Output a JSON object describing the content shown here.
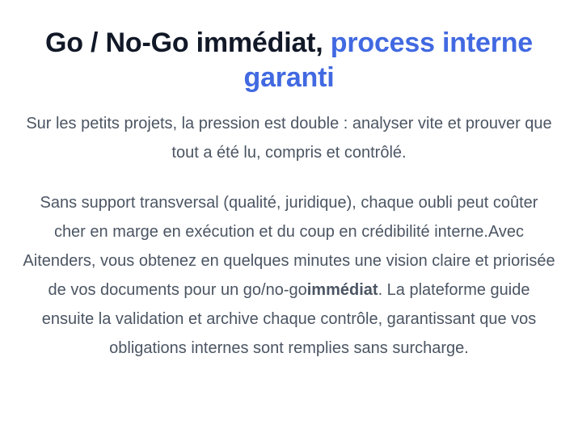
{
  "heading": {
    "part1": "Go / No-Go immédiat,",
    "accent": "process interne garanti"
  },
  "paragraph1": "Sur les petits projets, la pression est double : analyser vite et prouver que tout a été lu, compris et contrôlé.",
  "paragraph2": {
    "text_before": "Sans support transversal (qualité, juridique), chaque oubli peut coûter cher en marge en exécution et du coup en crédibilité interne.Avec Aitenders, vous obtenez en quelques minutes une vision claire et priorisée de vos documents pour un go/no-go",
    "bold": "immédiat",
    "text_after": ". La plateforme guide ensuite la validation et archive chaque contrôle, garantissant que vos obligations internes sont remplies sans surcharge."
  },
  "colors": {
    "heading": "#111827",
    "accent": "#4169e1",
    "body_text": "#4b5563",
    "background": "#ffffff"
  }
}
